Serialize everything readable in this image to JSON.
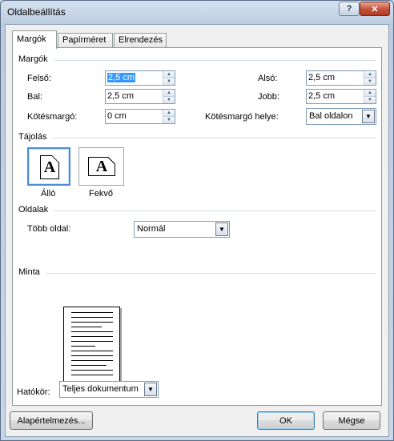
{
  "window": {
    "title": "Oldalbeállítás",
    "help_label": "?",
    "close_label": "✕"
  },
  "tabs": [
    {
      "label": "Margók",
      "active": true
    },
    {
      "label": "Papírméret",
      "active": false
    },
    {
      "label": "Elrendezés",
      "active": false
    }
  ],
  "margins": {
    "section_title": "Margók",
    "top_label": "Felső:",
    "top_value": "2,5 cm",
    "bottom_label": "Alsó:",
    "bottom_value": "2,5 cm",
    "left_label": "Bal:",
    "left_value": "2,5 cm",
    "right_label": "Jobb:",
    "right_value": "2,5 cm",
    "gutter_label": "Kötésmargó:",
    "gutter_value": "0 cm",
    "gutter_pos_label": "Kötésmargó helye:",
    "gutter_pos_value": "Bal oldalon"
  },
  "orientation": {
    "section_title": "Tájolás",
    "portrait_label": "Álló",
    "landscape_label": "Fekvő",
    "icon_glyph": "A",
    "selected": "portrait"
  },
  "pages": {
    "section_title": "Oldalak",
    "multiple_label": "Több oldal:",
    "multiple_value": "Normál"
  },
  "preview": {
    "section_title": "Minta"
  },
  "apply": {
    "label": "Hatókör:",
    "value": "Teljes dokumentum"
  },
  "buttons": {
    "default_label": "Alapértelmezés...",
    "ok_label": "OK",
    "cancel_label": "Mégse"
  },
  "icons": {
    "spin_up": "▲",
    "spin_down": "▼",
    "dropdown": "▼"
  },
  "colors": {
    "accent": "#3399ff",
    "selected_border": "#4b8cd6",
    "close_button": "#c4503a"
  }
}
